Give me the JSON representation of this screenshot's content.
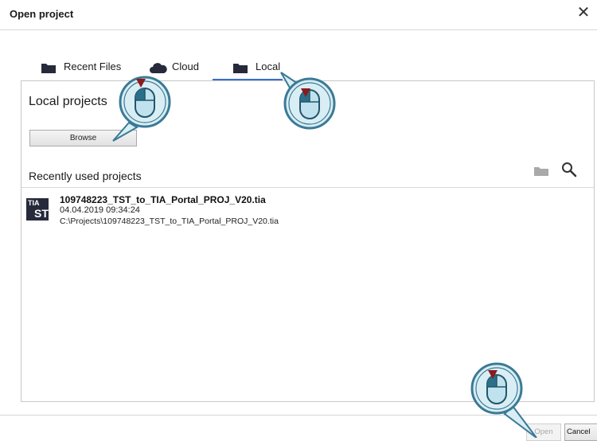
{
  "dialog": {
    "title": "Open project",
    "close_glyph": "✕"
  },
  "tabs": [
    {
      "label": "Recent Files",
      "icon": "folder-icon",
      "active": false
    },
    {
      "label": "Cloud",
      "icon": "cloud-icon",
      "active": false
    },
    {
      "label": "Local",
      "icon": "folder-icon",
      "active": true
    }
  ],
  "local": {
    "title": "Local projects",
    "browse_label": "Browse",
    "recent_title": "Recently used projects"
  },
  "projects": [
    {
      "name": "109748223_TST_to_TIA_Portal_PROJ_V20.tia",
      "date": "04.04.2019 09:34:24",
      "path": "C:\\Projects\\109748223_TST_to_TIA_Portal_PROJ_V20.tia",
      "logo_top": "TIA",
      "logo_bottom": "ST"
    }
  ],
  "footer": {
    "open_label": "Open",
    "cancel_label": "Cancel"
  },
  "colors": {
    "accent": "#3a70c9",
    "callout": "#3b7a96",
    "callout_fill": "#d9eef4",
    "arrow": "#8b1a1a"
  }
}
